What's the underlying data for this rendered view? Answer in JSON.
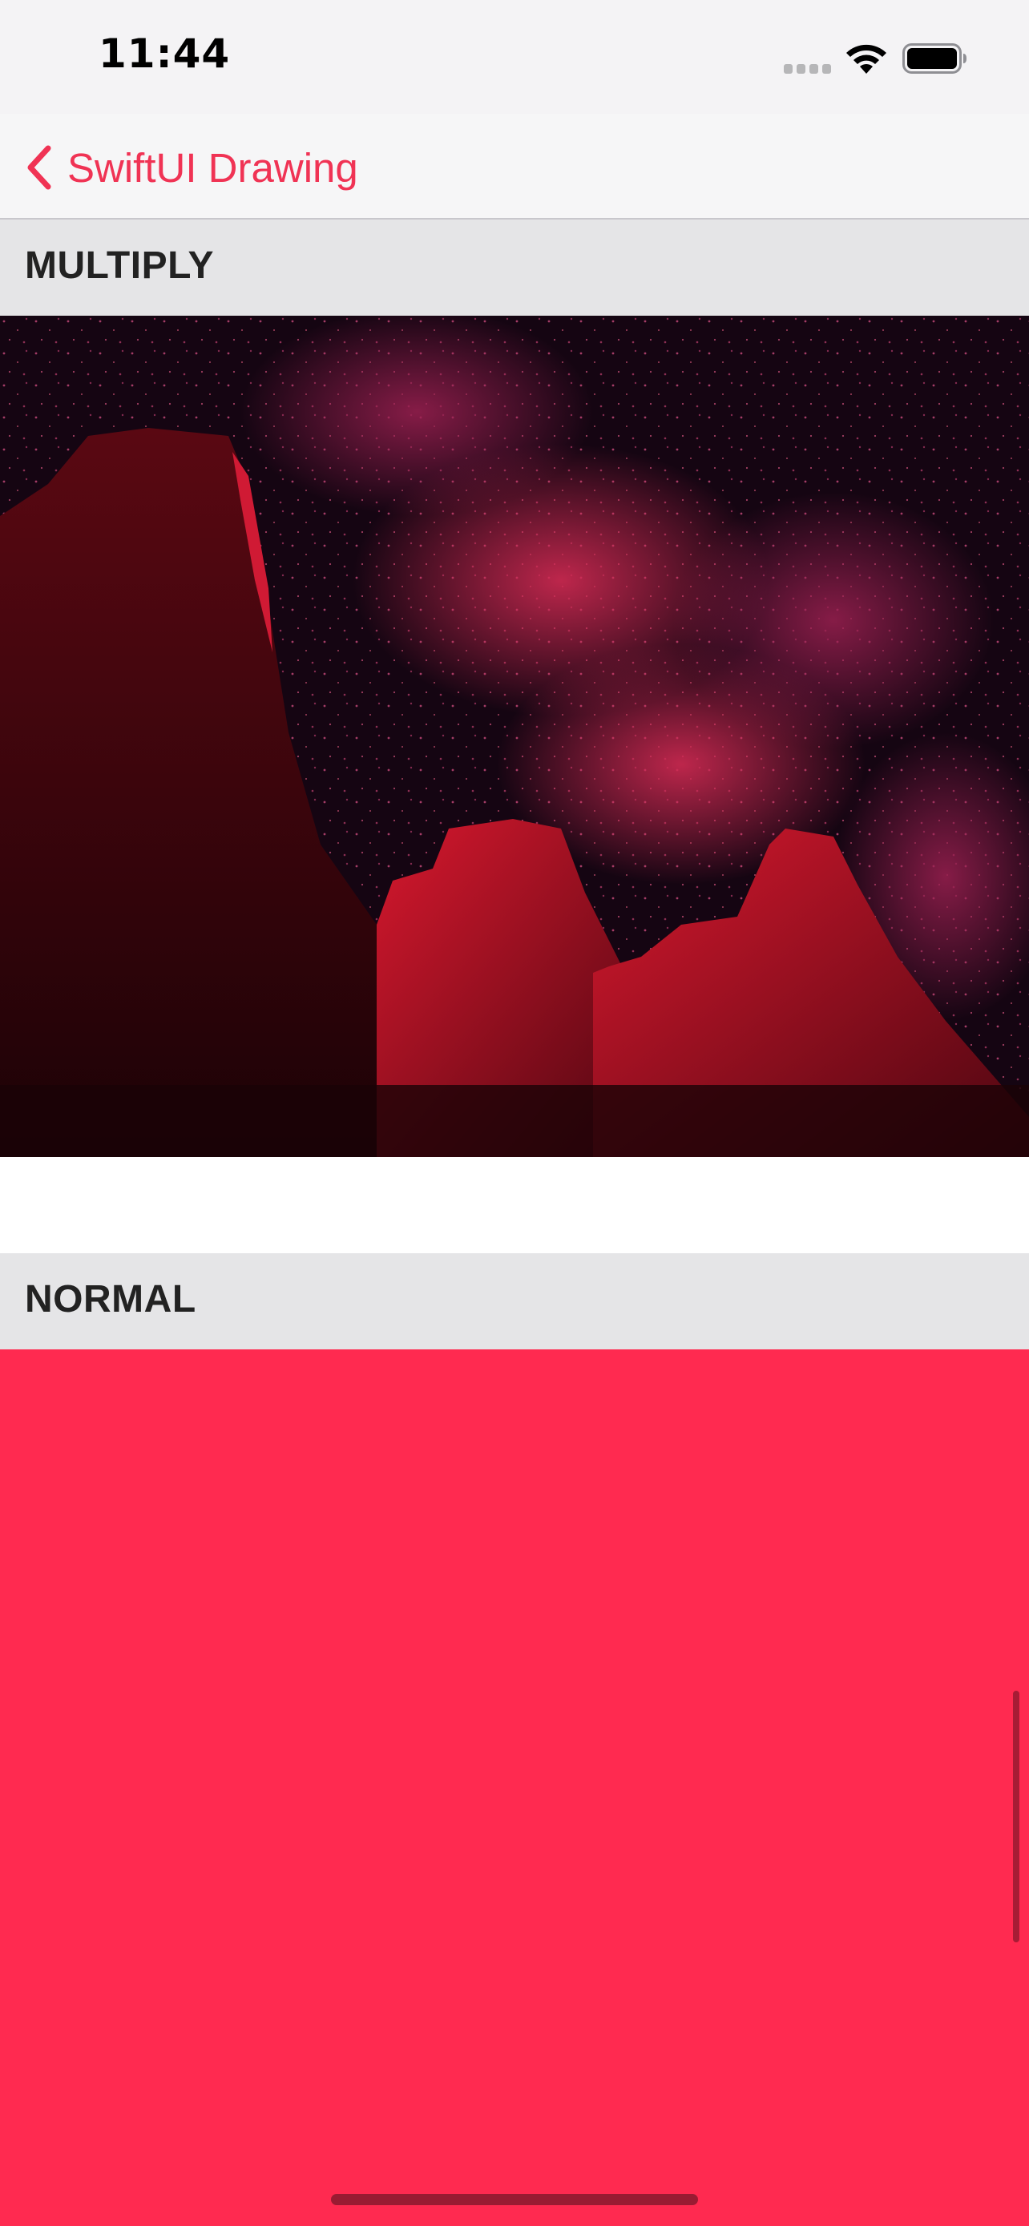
{
  "status_bar": {
    "time": "11:44",
    "signal_icon": "cellular-signal-icon",
    "wifi_icon": "wifi-icon",
    "battery_icon": "battery-icon"
  },
  "navigation": {
    "back_label": "SwiftUI Drawing",
    "back_icon": "chevron-left-icon"
  },
  "sections": [
    {
      "header": "MULTIPLY",
      "content": "image",
      "blend_color": "#ff2a50"
    },
    {
      "header": "NORMAL",
      "content": "color-fill",
      "fill_color": "#ff2a50"
    }
  ],
  "colors": {
    "accent": "#f03354",
    "section_header_bg": "#e5e5e7",
    "nav_bg": "#f6f6f7"
  }
}
